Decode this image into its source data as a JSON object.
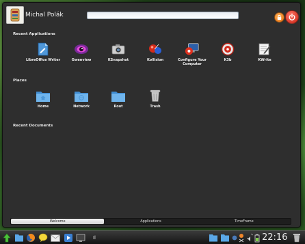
{
  "user": {
    "name": "Michal Polák"
  },
  "search": {
    "value": "",
    "placeholder": ""
  },
  "sections": {
    "recent_apps": "Recent Applications",
    "places": "Places",
    "recent_docs": "Recent Documents"
  },
  "apps": [
    {
      "label": "LibreOffice Writer",
      "icon": "libreoffice-writer-icon"
    },
    {
      "label": "Gwenview",
      "icon": "gwenview-icon"
    },
    {
      "label": "KSnapshot",
      "icon": "camera-icon"
    },
    {
      "label": "Kollision",
      "icon": "kollision-icon"
    },
    {
      "label": "Configure Your Computer",
      "icon": "system-settings-icon"
    },
    {
      "label": "K3b",
      "icon": "k3b-icon"
    },
    {
      "label": "KWrite",
      "icon": "kwrite-icon"
    }
  ],
  "places": [
    {
      "label": "Home",
      "icon": "home-folder-icon"
    },
    {
      "label": "Network",
      "icon": "network-folder-icon"
    },
    {
      "label": "Root",
      "icon": "root-folder-icon"
    },
    {
      "label": "Trash",
      "icon": "trash-icon"
    }
  ],
  "tabs": [
    {
      "label": "Welcome",
      "active": true
    },
    {
      "label": "Applications",
      "active": false
    },
    {
      "label": "TimeFrame",
      "active": false
    }
  ],
  "taskbar": {
    "clock": "22:16",
    "active_window_initial": "Il"
  },
  "colors": {
    "panel_bg": "#2e2e2e",
    "folder_blue": "#5aa7e6",
    "power_red": "#d62a1c",
    "lock_orange": "#f08a24"
  }
}
